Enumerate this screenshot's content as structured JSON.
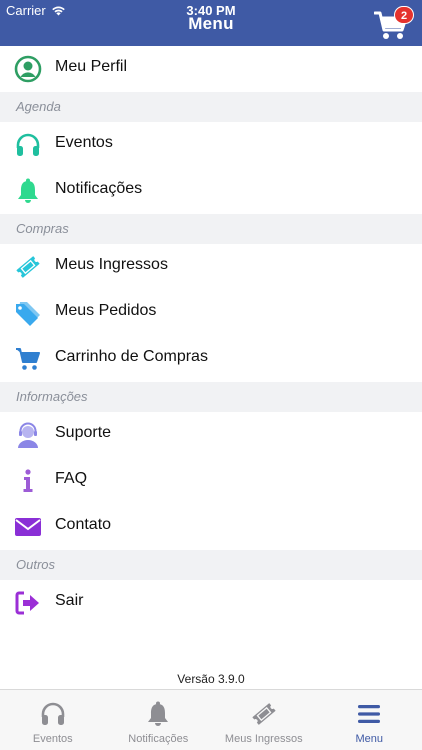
{
  "status_bar": {
    "carrier": "Carrier",
    "time": "3:40 PM"
  },
  "header": {
    "title": "Menu",
    "cart_icon": "cart-icon",
    "cart_badge": "2"
  },
  "colors": {
    "header": "#3f5aa5",
    "section_bg": "#f1f2f4",
    "active_tab": "#3f5aa5"
  },
  "menu": {
    "profile": {
      "label": "Meu Perfil",
      "icon": "user-circle-icon"
    },
    "sections": {
      "agenda": "Agenda",
      "compras": "Compras",
      "informacoes": "Informações",
      "outros": "Outros"
    },
    "items": {
      "eventos": {
        "label": "Eventos",
        "icon": "headphones-icon"
      },
      "notificacoes": {
        "label": "Notificações",
        "icon": "bell-icon"
      },
      "meus_ingressos": {
        "label": "Meus Ingressos",
        "icon": "ticket-icon"
      },
      "meus_pedidos": {
        "label": "Meus Pedidos",
        "icon": "tags-icon"
      },
      "carrinho": {
        "label": "Carrinho de Compras",
        "icon": "cart-icon"
      },
      "suporte": {
        "label": "Suporte",
        "icon": "support-agent-icon"
      },
      "faq": {
        "label": "FAQ",
        "icon": "info-icon"
      },
      "contato": {
        "label": "Contato",
        "icon": "envelope-icon"
      },
      "sair": {
        "label": "Sair",
        "icon": "sign-out-icon"
      }
    }
  },
  "footer": {
    "version": "Versão 3.9.0"
  },
  "tabbar": {
    "tabs": [
      {
        "label": "Eventos",
        "icon": "headphones-icon"
      },
      {
        "label": "Notificações",
        "icon": "bell-icon"
      },
      {
        "label": "Meus Ingressos",
        "icon": "ticket-icon"
      },
      {
        "label": "Menu",
        "icon": "hamburger-icon"
      }
    ],
    "active": "Menu"
  }
}
